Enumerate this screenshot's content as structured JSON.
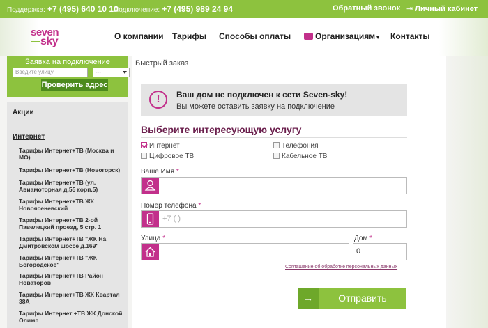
{
  "topbar": {
    "support_label": "Поддержка:",
    "support_phone": "+7 (495) 640 10 10",
    "connect_label": "Подключение:",
    "connect_phone": "+7 (495) 989 24 94",
    "callback": "Обратный звонок",
    "cabinet": "Личный кабинет",
    "cabinet_icon": "login-icon"
  },
  "logo": {
    "line1": "seven",
    "line2": "sky"
  },
  "nav": [
    "О компании",
    "Тарифы",
    "Способы оплаты",
    "Организациям",
    "Контакты"
  ],
  "quick_request": {
    "title": "Заявка на подключение",
    "street_placeholder": "Введите улицу",
    "house_value": "---",
    "check_button": "Проверить адрес"
  },
  "sidebar": {
    "akcii": "Акции",
    "internet": "Интернет",
    "items": [
      "Тарифы Интернет+ТВ (Москва и МО)",
      "Тарифы Интернет+ТВ (Новогорск)",
      "Тарифы Интернет+ТВ (ул. Авиамоторная д.55 корп.5)",
      "Тарифы Интернет+ТВ ЖК Новоясеневский",
      "Тарифы Интернет+ТВ 2-ой Павелецкий проезд, 5 стр. 1",
      "Тарифы Интернет+ТВ \"ЖК На Дмитровском шоссе д.169\"",
      "Тарифы Интернет+ТВ \"ЖК Богородское\"",
      "Тарифы Интернет+ТВ Район Новаторов",
      "Тарифы Интернет+ТВ ЖК Квартал 38А",
      "Тарифы Интернет +ТВ ЖК Донской Олимп"
    ]
  },
  "main": {
    "quick_order": "Быстрый заказ",
    "alert_title": "Ваш дом не подключен к сети Seven-sky!",
    "alert_sub": "Вы можете оставить заявку на подключение",
    "service_title": "Выберите интересующую услугу",
    "options": [
      {
        "label": "Интернет",
        "checked": true
      },
      {
        "label": "Телефония",
        "checked": false
      },
      {
        "label": "Цифровое ТВ",
        "checked": false
      },
      {
        "label": "Кабельное ТВ",
        "checked": false
      }
    ],
    "name_label": "Ваше Имя",
    "phone_label": "Номер телефона",
    "phone_placeholder": "+7 (      )",
    "street_label": "Улица",
    "house_label": "Дом",
    "house_value": "0",
    "required_mark": "*",
    "consent": "Соглашение об обработке персональных данных",
    "submit": "Отправить"
  },
  "colors": {
    "green": "#8dc23e",
    "magenta": "#c2308b",
    "dark_green": "#4c8a1d"
  }
}
